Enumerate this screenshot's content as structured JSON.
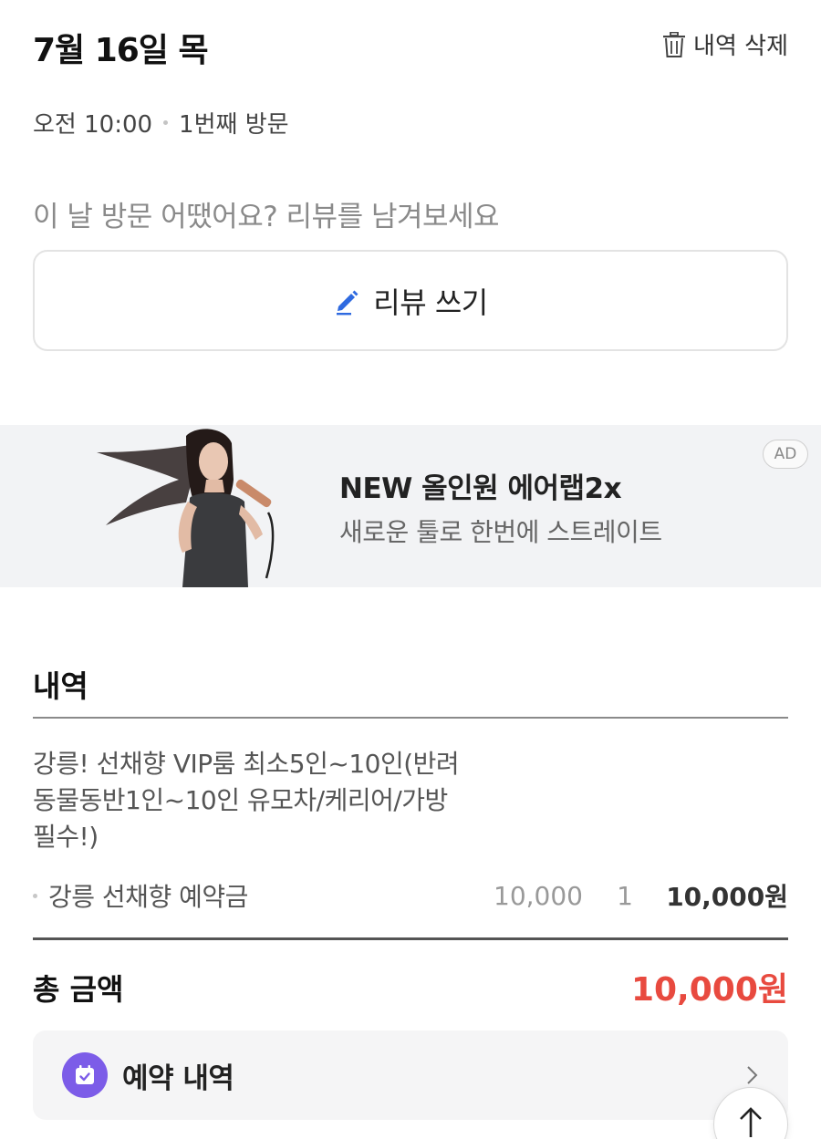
{
  "header": {
    "date": "7월 16일 목",
    "delete_label": "내역 삭제"
  },
  "visit": {
    "time": "오전 10:00",
    "count": "1번째 방문"
  },
  "review": {
    "prompt": "이 날 방문 어땠어요? 리뷰를 남겨보세요",
    "button_label": "리뷰 쓰기"
  },
  "ad": {
    "title": "NEW 올인원 에어랩2x",
    "subtitle": "새로운 툴로 한번에 스트레이트",
    "badge": "AD"
  },
  "details": {
    "section_title": "내역",
    "product_name": "강릉! 선채향 VIP룸 최소5인~10인(반려동물동반1인~10인 유모차/케리어/가방필수!)",
    "option": {
      "name": "강릉 선채향 예약금",
      "unit_price": "10,000",
      "quantity": "1",
      "total": "10,000원"
    }
  },
  "total": {
    "label": "총 금액",
    "value": "10,000원"
  },
  "booking": {
    "label": "예약 내역"
  },
  "colors": {
    "accent_red": "#e84a3f",
    "accent_purple": "#7c5ce8",
    "pencil_blue": "#2f6ae0"
  }
}
